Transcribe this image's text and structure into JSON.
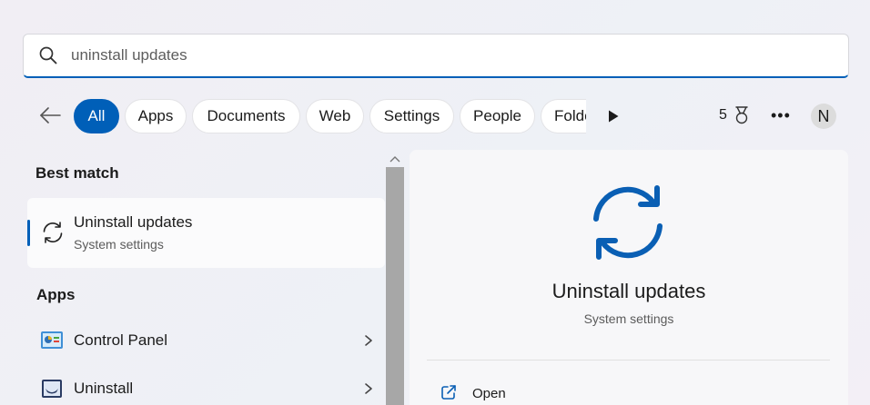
{
  "search": {
    "value": "uninstall updates",
    "icon": "search-icon"
  },
  "filters": {
    "back_icon": "arrow-left-icon",
    "pills": [
      {
        "label": "All",
        "active": true
      },
      {
        "label": "Apps"
      },
      {
        "label": "Documents"
      },
      {
        "label": "Web"
      },
      {
        "label": "Settings"
      },
      {
        "label": "People"
      },
      {
        "label": "Folde"
      }
    ],
    "more_filters_icon": "play-icon",
    "rewards_count": "5",
    "rewards_icon": "trophy-icon",
    "more_label": "•••",
    "avatar_initial": "N"
  },
  "results": {
    "best_match_heading": "Best match",
    "best_match": {
      "name": "Uninstall updates",
      "subtitle": "System settings",
      "icon": "sync-icon"
    },
    "apps_heading": "Apps",
    "apps": [
      {
        "name": "Control Panel",
        "icon": "control-panel-icon"
      },
      {
        "name": "Uninstall",
        "icon": "uninstall-icon"
      }
    ]
  },
  "preview": {
    "title": "Uninstall updates",
    "subtitle": "System settings",
    "icon": "sync-icon",
    "actions": [
      {
        "label": "Open",
        "icon": "open-external-icon"
      }
    ]
  },
  "colors": {
    "accent": "#005fb8"
  }
}
